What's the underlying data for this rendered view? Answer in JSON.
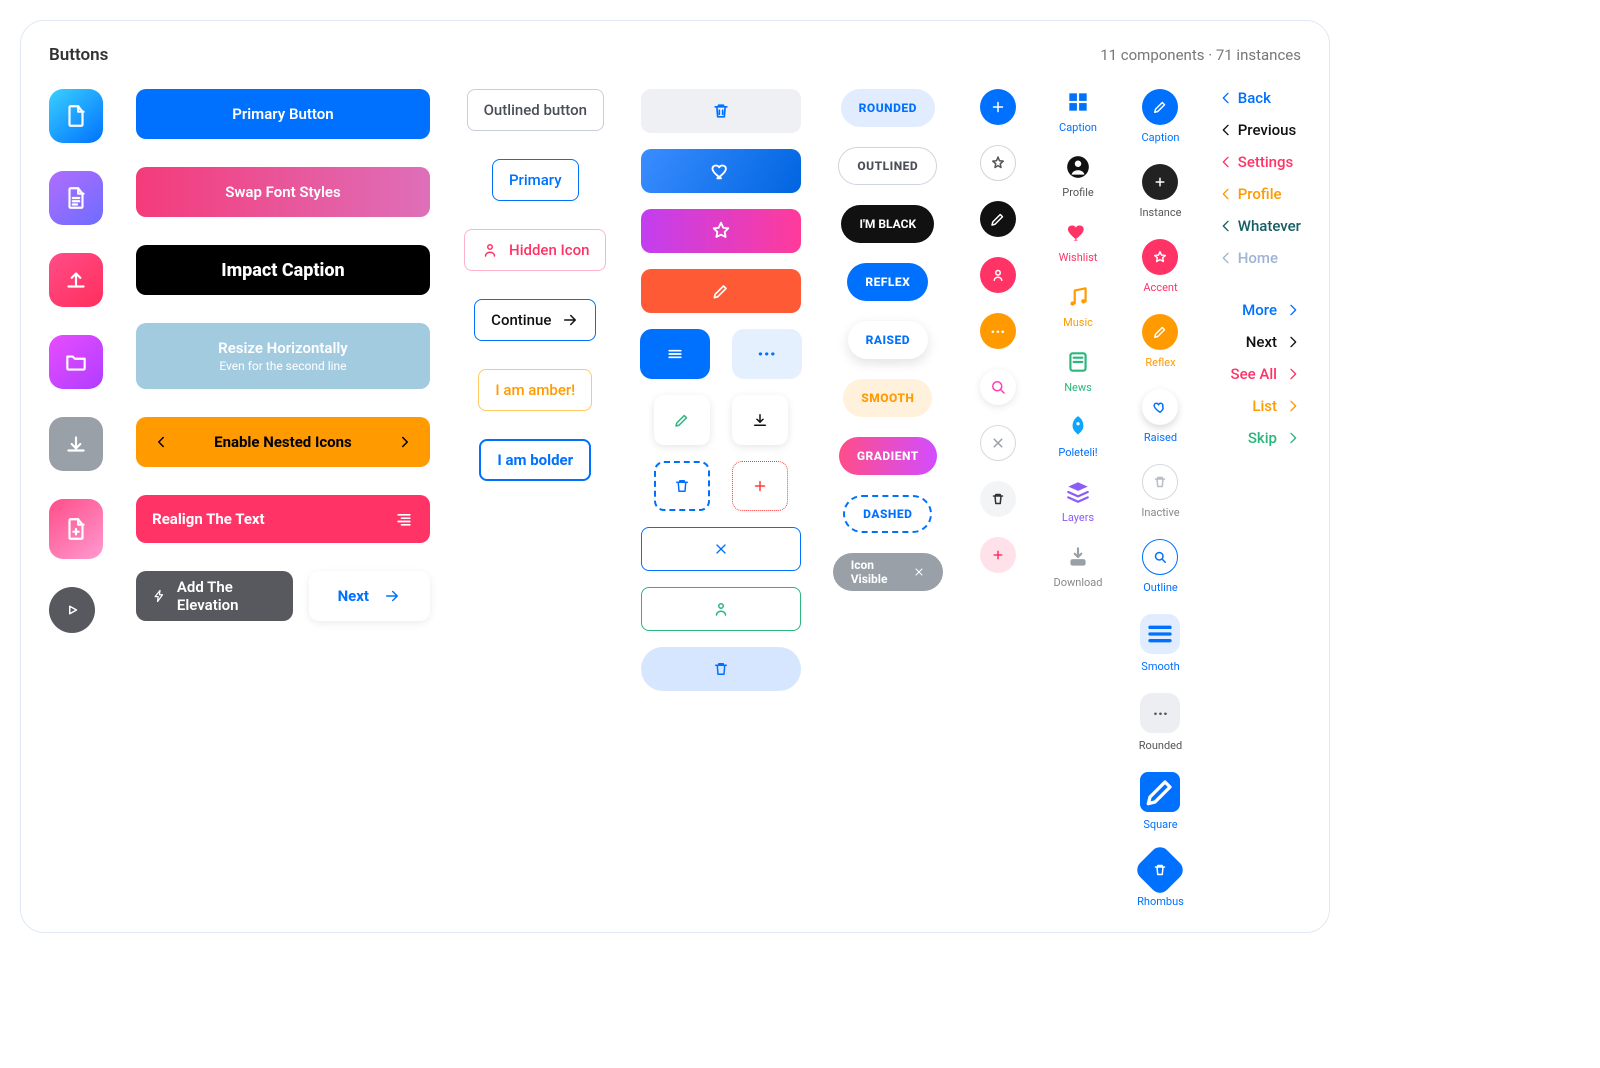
{
  "header": {
    "title": "Buttons",
    "meta": "11 components · 71 instances"
  },
  "wide": {
    "primary": "Primary Button",
    "swap": "Swap Font Styles",
    "impact": "Impact Caption",
    "resize": "Resize Horizontally",
    "resize_sub": "Even for the second line",
    "nested": "Enable Nested Icons",
    "realign": "Realign The Text",
    "elevation": "Add The Elevation",
    "next": "Next"
  },
  "outlined": {
    "plain": "Outlined button",
    "primary": "Primary",
    "hidden": "Hidden Icon",
    "continue": "Continue",
    "amber": "I am amber!",
    "bolder": "I am bolder"
  },
  "chips": {
    "rounded": "ROUNDED",
    "outlined": "OUTLINED",
    "black": "I'M BLACK",
    "reflex": "REFLEX",
    "raised": "RAISED",
    "smooth": "SMOOTH",
    "gradient": "GRADIENT",
    "dashed": "DASHED",
    "icon_visible": "Icon Visible"
  },
  "labeled": {
    "caption": "Caption",
    "profile": "Profile",
    "wishlist": "Wishlist",
    "music": "Music",
    "news": "News",
    "poleteli": "Poleteli!",
    "layers": "Layers",
    "download": "Download",
    "instance": "Instance",
    "accent": "Accent",
    "reflex": "Reflex",
    "raised": "Raised",
    "inactive": "Inactive",
    "outline": "Outline",
    "smooth": "Smooth",
    "rounded": "Rounded",
    "square": "Square",
    "rhombus": "Rhombus"
  },
  "links_left": [
    {
      "label": "Back",
      "color": "#0071ff"
    },
    {
      "label": "Previous",
      "color": "#111"
    },
    {
      "label": "Settings",
      "color": "#ff3366"
    },
    {
      "label": "Profile",
      "color": "#ff9a00"
    },
    {
      "label": "Whatever",
      "color": "#155e63"
    },
    {
      "label": "Home",
      "color": "#9fb4d1"
    }
  ],
  "links_right": [
    {
      "label": "More",
      "color": "#0071ff"
    },
    {
      "label": "Next",
      "color": "#111"
    },
    {
      "label": "See All",
      "color": "#ff3366"
    },
    {
      "label": "List",
      "color": "#ff9a00"
    },
    {
      "label": "Skip",
      "color": "#2ab67d"
    }
  ]
}
